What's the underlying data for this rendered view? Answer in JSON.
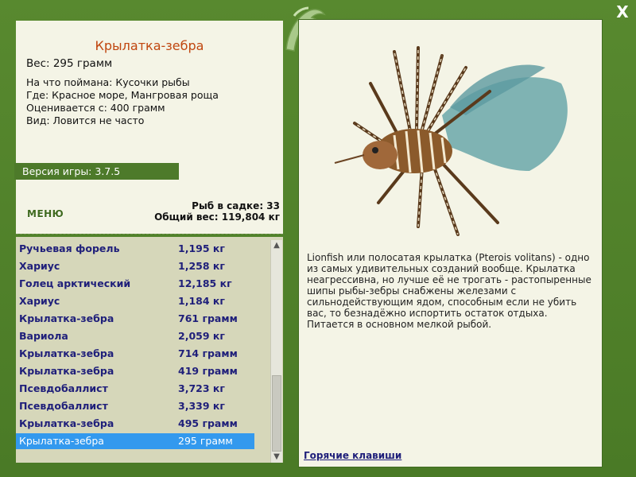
{
  "window": {
    "close_glyph": "X"
  },
  "fish_card": {
    "title": "Крылатка-зебра",
    "weight": "Вес: 295 грамм",
    "caught_on": "На что поймана: Кусочки рыбы",
    "where": "Где: Красное море, Мангровая роща",
    "valued_from": "Оценивается с: 400 грамм",
    "kind": "Вид: Ловится не часто"
  },
  "version": "Версия игры: 3.7.5",
  "menu_label": "МЕНЮ",
  "stats": {
    "fish_in_keepnet": "Рыб в садке: 33",
    "total_weight": "Общий вес: 119,804 кг"
  },
  "catch_list": [
    {
      "name": "Ручьевая форель",
      "weight": "1,195 кг"
    },
    {
      "name": "Хариус",
      "weight": "1,258 кг"
    },
    {
      "name": "Голец арктический",
      "weight": "12,185 кг"
    },
    {
      "name": "Хариус",
      "weight": "1,184 кг"
    },
    {
      "name": "Крылатка-зебра",
      "weight": "761 грамм"
    },
    {
      "name": "Вариола",
      "weight": "2,059 кг"
    },
    {
      "name": "Крылатка-зебра",
      "weight": "714 грамм"
    },
    {
      "name": "Крылатка-зебра",
      "weight": "419 грамм"
    },
    {
      "name": "Псевдобаллист",
      "weight": "3,723 кг"
    },
    {
      "name": "Псевдобаллист",
      "weight": "3,339 кг"
    },
    {
      "name": "Крылатка-зебра",
      "weight": "495 грамм"
    },
    {
      "name": "Крылатка-зебра",
      "weight": "295 грамм",
      "selected": true
    }
  ],
  "description": "Lionfish или полосатая крылатка (Pterois volitans) - одно из самых удивительных созданий вообще. Крылатка неагрессивна, но лучше её не трогать - растопыренные шипы рыбы-зебры снабжены железами с сильнодействующим ядом, способным если не убить вас, то безнадёжно испортить остаток отдыха. Питается в основном мелкой рыбой.",
  "hotkeys_label": "Горячие клавиши",
  "colors": {
    "frame_green": "#4d7a2a",
    "panel_bg": "#f4f4e6",
    "title_orange": "#c0460f",
    "list_text_navy": "#1f1f7a",
    "selection_blue": "#3399ee",
    "list_bg": "#d6d7ba"
  },
  "icons": {
    "close": "close-icon",
    "logo": "dolphin-logo-icon",
    "scroll_up": "chevron-up-icon",
    "scroll_down": "chevron-down-icon"
  }
}
